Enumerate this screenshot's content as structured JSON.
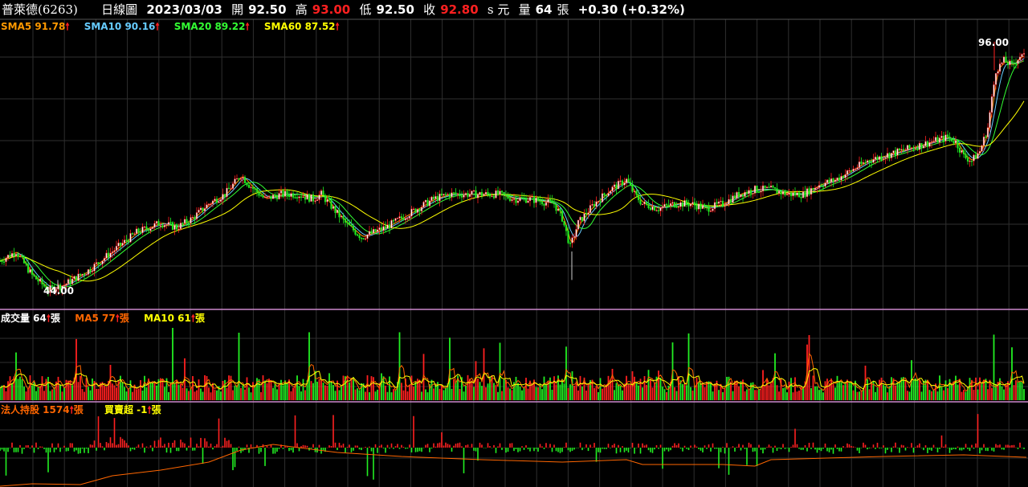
{
  "header": {
    "stock_name": "普萊德(6263)",
    "chart_kind": "日線圖",
    "date": "2023/03/03",
    "open_label": "開",
    "open_value": "92.50",
    "high_label": "高",
    "high_value": "93.00",
    "low_label": "低",
    "low_value": "92.50",
    "close_label": "收",
    "close_value": "92.80",
    "unit_label": "s 元",
    "volume_label": "量",
    "volume_value": "64",
    "volume_unit": "張",
    "change": "+0.30 (+0.32%)"
  },
  "price_legend": [
    {
      "label": "SMA5 91.78",
      "color": "#ff9900"
    },
    {
      "label": "SMA10 90.16",
      "color": "#66ccff"
    },
    {
      "label": "SMA20 89.22",
      "color": "#33ff33"
    },
    {
      "label": "SMA60 87.52",
      "color": "#ffff00"
    }
  ],
  "volume_legend": [
    {
      "label": "成交量 64",
      "unit": "張",
      "color": "#ffffff"
    },
    {
      "label": "MA5 77",
      "unit": "張",
      "color": "#ff6600"
    },
    {
      "label": "MA10 61",
      "unit": "張",
      "color": "#ffff00"
    }
  ],
  "inst_legend": [
    {
      "label": "法人持股 1574",
      "unit": "張",
      "color": "#ff6600"
    },
    {
      "label": "買賣超 -1",
      "unit": "張",
      "color": "#ffff00"
    }
  ],
  "annotations": {
    "high": "96.00",
    "low": "44.00"
  },
  "colors": {
    "up": "#ff2020",
    "down": "#22ee22",
    "grid": "#2f2f2f",
    "divider": "#cc88cc"
  },
  "chart_data": {
    "type": "candlestick",
    "title": "普萊德(6263) 日線圖",
    "series_close_anchors": [
      [
        0,
        50
      ],
      [
        20,
        52
      ],
      [
        40,
        47
      ],
      [
        60,
        44
      ],
      [
        80,
        45
      ],
      [
        110,
        48
      ],
      [
        140,
        52
      ],
      [
        170,
        56
      ],
      [
        200,
        58
      ],
      [
        220,
        57
      ],
      [
        240,
        59
      ],
      [
        260,
        62
      ],
      [
        280,
        64
      ],
      [
        300,
        68
      ],
      [
        310,
        66
      ],
      [
        330,
        63
      ],
      [
        350,
        64
      ],
      [
        370,
        64
      ],
      [
        390,
        63
      ],
      [
        400,
        64
      ],
      [
        410,
        62
      ],
      [
        430,
        58
      ],
      [
        450,
        55
      ],
      [
        480,
        57
      ],
      [
        500,
        59
      ],
      [
        520,
        61
      ],
      [
        540,
        63
      ],
      [
        560,
        64
      ],
      [
        580,
        64
      ],
      [
        600,
        64
      ],
      [
        620,
        64
      ],
      [
        640,
        63
      ],
      [
        660,
        63
      ],
      [
        690,
        62
      ],
      [
        700,
        59
      ],
      [
        710,
        53
      ],
      [
        720,
        58
      ],
      [
        740,
        62
      ],
      [
        760,
        65
      ],
      [
        780,
        67
      ],
      [
        790,
        64
      ],
      [
        800,
        62
      ],
      [
        820,
        61
      ],
      [
        840,
        62
      ],
      [
        860,
        62
      ],
      [
        880,
        61
      ],
      [
        900,
        62
      ],
      [
        920,
        64
      ],
      [
        940,
        65
      ],
      [
        960,
        65
      ],
      [
        980,
        64
      ],
      [
        1000,
        64
      ],
      [
        1020,
        66
      ],
      [
        1040,
        67
      ],
      [
        1060,
        69
      ],
      [
        1080,
        71
      ],
      [
        1100,
        72
      ],
      [
        1120,
        73
      ],
      [
        1140,
        74
      ],
      [
        1160,
        75
      ],
      [
        1180,
        76
      ],
      [
        1190,
        75
      ],
      [
        1200,
        72
      ],
      [
        1210,
        71
      ],
      [
        1220,
        73
      ],
      [
        1230,
        78
      ],
      [
        1240,
        90
      ],
      [
        1250,
        92
      ],
      [
        1260,
        91
      ],
      [
        1270,
        93
      ],
      [
        1276,
        92.8
      ]
    ],
    "high": 96.0,
    "low": 44.0,
    "last_bar": {
      "date": "2023/03/03",
      "open": 92.5,
      "high": 93.0,
      "low": 92.5,
      "close": 92.8,
      "volume": 64,
      "change": 0.3,
      "change_pct": 0.32
    },
    "sma": {
      "sma5": 91.78,
      "sma10": 90.16,
      "sma20": 89.22,
      "sma60": 87.52
    },
    "volume": {
      "last": 64,
      "ma5": 77,
      "ma10": 61
    },
    "institutional": {
      "holding": 1574,
      "net_buy_sell": -1
    }
  }
}
